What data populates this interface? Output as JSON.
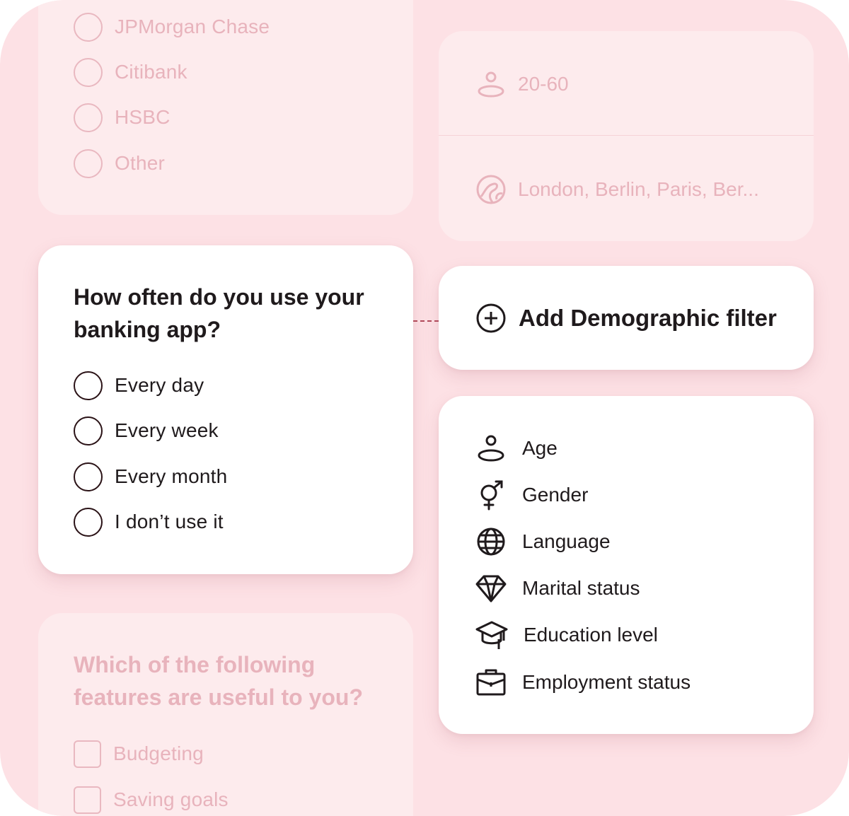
{
  "bank_question": {
    "options": [
      "JPMorgan Chase",
      "Citibank",
      "HSBC",
      "Other"
    ]
  },
  "usage_question": {
    "title": "How often do you use your banking app?",
    "options": [
      "Every day",
      "Every week",
      "Every month",
      "I don’t use it"
    ]
  },
  "features_question": {
    "title": "Which of the following features are useful to you?",
    "options": [
      "Budgeting",
      "Saving goals"
    ]
  },
  "filter_summary": {
    "age_value": "20-60",
    "location_value": "London, Berlin, Paris, Ber..."
  },
  "add_filter": {
    "label": "Add Demographic filter"
  },
  "filter_menu": {
    "items": [
      {
        "label": "Age",
        "icon": "person-icon"
      },
      {
        "label": "Gender",
        "icon": "gender-icon"
      },
      {
        "label": "Language",
        "icon": "globe-icon"
      },
      {
        "label": "Marital status",
        "icon": "diamond-icon"
      },
      {
        "label": "Education level",
        "icon": "graduation-cap-icon"
      },
      {
        "label": "Employment status",
        "icon": "briefcase-icon"
      }
    ]
  },
  "colors": {
    "background": "#fde1e5",
    "faded_card": "#fdebed",
    "faded_text": "#e8b3bc",
    "dark_text": "#1f1a1c",
    "connector": "#b14a5a"
  }
}
